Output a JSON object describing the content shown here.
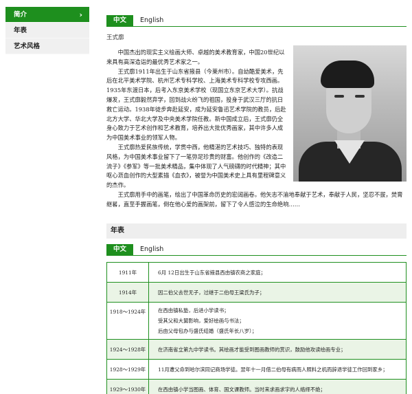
{
  "sidebar": {
    "items": [
      {
        "label": "简介",
        "active": true
      },
      {
        "label": "年表",
        "active": false
      },
      {
        "label": "艺术风格",
        "active": false
      }
    ]
  },
  "intro": {
    "tabs": [
      {
        "label": "中文",
        "active": true
      },
      {
        "label": "English",
        "active": false
      }
    ],
    "author": "王式廓",
    "paragraphs": [
      "中国杰出的现实主义绘画大师、卓越的美术教育家，中国20世纪以来具有高深造诣的最优秀艺术家之一。",
      "王式廓1911年出生于山东省掖县（今莱州市）。自幼酷爱美术，先后在北平美术学院、杭州艺术专科学校、上海美术专科学校专攻西画。1935年东渡日本，后考入东京美术学校（现国立东京艺术大学）。抗战爆发，王式廓毅然弃学，回到战火纷飞的祖国，投身于武汉三厅的抗日救亡运动。1938年徒步奔赴延安，成为延安鲁迅艺术学院的教员，后赴北方大学、华北大学及中央美术学院任教。新中国成立后，王式廓仍全身心致力于艺术创作和艺术教育，培养出大批优秀画家，其中许多人成为中国美术事业的领军人物。",
      "王式廓热爱民族传统，学贯中西，他精湛的艺术技巧、独特的表现风格，为中国美术事业留下了一笔弥足珍贵的财富。他创作的《改造二流子》《参军》等一批美术精品，集中体现了人气磅礴的时代精神；其中呕心沥血创作的大型素描《血衣》，被誉为中国美术史上具有里程碑意义的杰作。",
      "王式廓用手中的画笔，绘出了中国革命历史的宏阔画卷。他矢志不渝地奉献于艺术，奉献于人民，坚忍不拔，焚膏继晷，直至手握画笔，倒在他心爱的画架前，留下了令人感泣的生命绝响……"
    ],
    "portrait_icon": "portrait-photo"
  },
  "chronology": {
    "title": "年表",
    "tabs": [
      {
        "label": "中文",
        "active": true
      },
      {
        "label": "English",
        "active": false
      }
    ],
    "rows": [
      {
        "year": "1911年",
        "events": [
          "6月 12日出生于山东省掖县西由镇农商之家庭；"
        ]
      },
      {
        "year": "1914年",
        "events": [
          "因二伯父去世无子，过继于二伯母王梁氏为子；"
        ]
      },
      {
        "year": "1918～1924年",
        "events": [
          "在西由镇私塾，后进小学读书；",
          "受其父和大舅影响，爱好绘画与书法；",
          "后由父母包办与盛氏结婚（盛氏年长八岁）；"
        ]
      },
      {
        "year": "1924～1928年",
        "events": [
          "在济南省立第九中学读书。其绘画才能受到图画教师的赏识，鼓励他攻读绘画专业；"
        ]
      },
      {
        "year": "1928～1929年",
        "events": [
          "11月遭父命到哈尔滨同记商场学徒。翌年十一月借二伯母有病而人照料之机而辞退学徒工作回到家乡；"
        ]
      },
      {
        "year": "1929～1930年",
        "events": [
          "在西由镇小学当图画、体育、国文课教师。当时来求画求字的人络绎不绝；"
        ]
      }
    ]
  },
  "colors": {
    "accent": "#1e8f1e",
    "sidebar_bg": "#f0f0f0",
    "alt_row": "#eaf4e6"
  }
}
